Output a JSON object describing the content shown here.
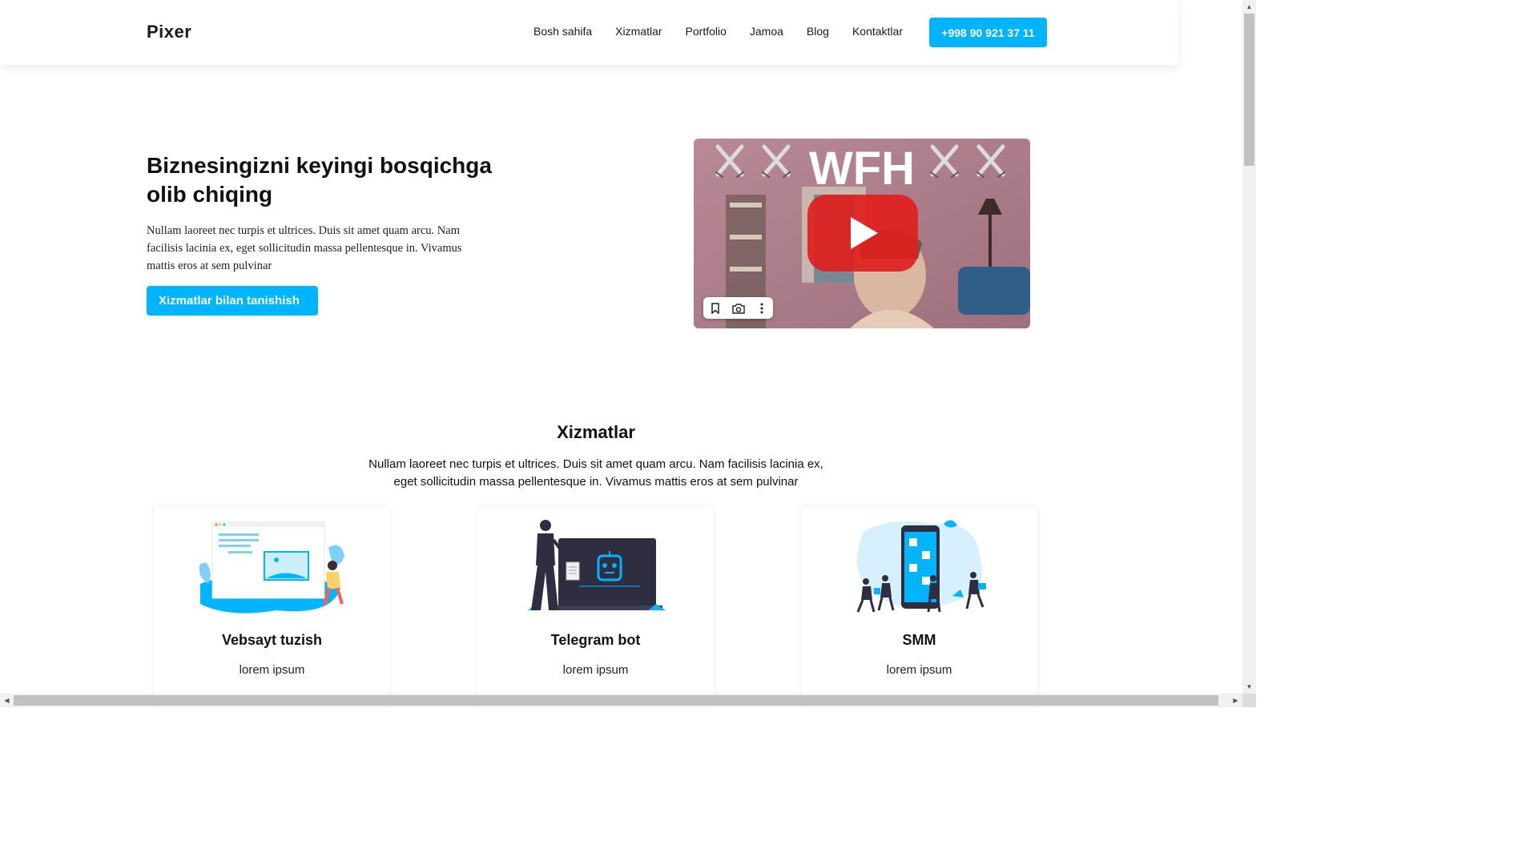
{
  "header": {
    "logo": "Pixer",
    "nav": [
      "Bosh sahifa",
      "Xizmatlar",
      "Portfolio",
      "Jamoa",
      "Blog",
      "Kontaktlar"
    ],
    "phone": "+998 90 921 37 11"
  },
  "hero": {
    "title": "Biznesingizni keyingi bosqichga olib chiqing",
    "text": "Nullam laoreet nec turpis et ultrices. Duis sit amet quam arcu. Nam facilisis lacinia ex, eget sollicitudin massa pellentesque in. Vivamus mattis eros at sem pulvinar",
    "button": "Xizmatlar bilan tanishish"
  },
  "video": {
    "overlay_text": "WFH",
    "icons": [
      "play-icon",
      "bookmark-icon",
      "camera-icon",
      "more-vertical-icon"
    ]
  },
  "services": {
    "title": "Xizmatlar",
    "text": "Nullam laoreet nec turpis et ultrices. Duis sit amet quam arcu. Nam facilisis lacinia ex, eget sollicitudin massa pellentesque in. Vivamus mattis eros at sem pulvinar",
    "cards": [
      {
        "title": "Vebsayt tuzish",
        "subtitle": "lorem ipsum"
      },
      {
        "title": "Telegram bot",
        "subtitle": "lorem ipsum"
      },
      {
        "title": "SMM",
        "subtitle": "lorem ipsum"
      }
    ]
  },
  "colors": {
    "accent": "#00b4ff",
    "text": "#111111",
    "background": "#ffffff"
  }
}
